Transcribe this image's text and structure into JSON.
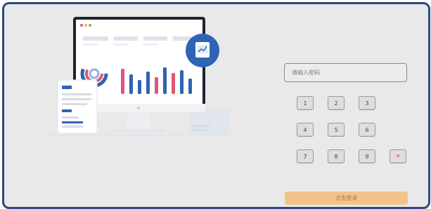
{
  "login": {
    "password_placeholder": "请输入密码",
    "submit_label": "点击登录"
  },
  "keypad": {
    "keys": [
      "1",
      "2",
      "3",
      "4",
      "5",
      "6",
      "7",
      "8",
      "9",
      "×"
    ]
  },
  "colors": {
    "frame_border": "#2b4a7f",
    "background": "#e9e9e9",
    "accent_blue": "#2f64b4",
    "accent_pink": "#e0567a",
    "login_button": "#f2c48a",
    "delete_key": "#d9534f"
  },
  "icons": {
    "badge": "chart-badge-icon",
    "delete": "delete-key-icon"
  }
}
